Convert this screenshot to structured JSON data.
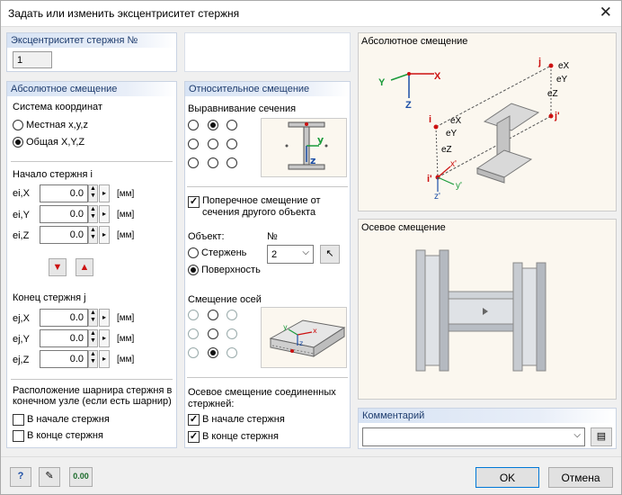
{
  "window": {
    "title": "Задать или изменить эксцентриситет стержня",
    "close": "✕"
  },
  "ecc_no": {
    "header": "Эксцентриситет стержня №",
    "value": "1"
  },
  "absolute": {
    "header": "Абсолютное смещение",
    "coord_system_label": "Система координат",
    "local_label": "Местная x,y,z",
    "global_label": "Общая X,Y,Z",
    "start_label": "Начало стержня  i",
    "end_label": "Конец стержня j",
    "start_rows": [
      {
        "label": "ei,X",
        "value": "0.0",
        "unit": "[мм]"
      },
      {
        "label": "ei,Y",
        "value": "0.0",
        "unit": "[мм]"
      },
      {
        "label": "ei,Z",
        "value": "0.0",
        "unit": "[мм]"
      }
    ],
    "end_rows": [
      {
        "label": "ej,X",
        "value": "0.0",
        "unit": "[мм]"
      },
      {
        "label": "ej,Y",
        "value": "0.0",
        "unit": "[мм]"
      },
      {
        "label": "ej,Z",
        "value": "0.0",
        "unit": "[мм]"
      }
    ],
    "hinge_label": "Расположение шарнира стержня в конечном узле (если есть шарнир)",
    "hinge_start": "В начале стержня",
    "hinge_end": "В конце стержня"
  },
  "relative": {
    "header": "Относительное смещение",
    "section_align_label": "Выравнивание сечения",
    "cross_offset_label": "Поперечное смещение от сечения другого объекта",
    "object_label": "Объект:",
    "no_label": "№",
    "member_label": "Стержень",
    "surface_label": "Поверхность",
    "no_value": "2",
    "axis_offset_label": "Смещение осей",
    "axial_connected_label": "Осевое смещение соединенных стержней:",
    "axial_start": "В начале стержня",
    "axial_end": "В конце стержня"
  },
  "diagrams": {
    "absolute_title": "Абсолютное смещение",
    "axial_title": "Осевое смещение",
    "labels": {
      "i": "i",
      "j": "j",
      "ip": "i'",
      "jp": "j'",
      "x": "X",
      "y": "Y",
      "z": "Z",
      "ex": "eX",
      "ey": "eY",
      "ez": "eZ",
      "xp": "x'",
      "yp": "y'",
      "zp": "z'"
    }
  },
  "comment": {
    "header": "Комментарий",
    "value": ""
  },
  "footer": {
    "ok": "OK",
    "cancel": "Отмена",
    "calc_icon_text": "0.00"
  },
  "colors": {
    "accent": "#1e3c6e",
    "red": "#cc1111",
    "blue": "#1d4fa6",
    "green": "#1a9a3a"
  }
}
